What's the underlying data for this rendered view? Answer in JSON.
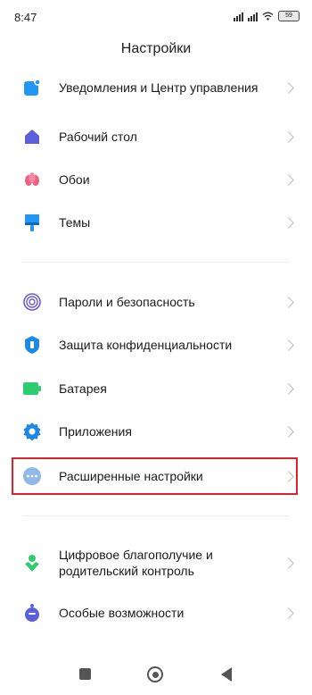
{
  "status_bar": {
    "time": "8:47",
    "battery": "59"
  },
  "header": {
    "title": "Настройки"
  },
  "items": [
    {
      "label": "Уведомления и Центр управления",
      "icon": "notifications-icon",
      "color": "#2196f3"
    },
    {
      "label": "Рабочий стол",
      "icon": "home-icon",
      "color": "#5b5fd9"
    },
    {
      "label": "Обои",
      "icon": "wallpaper-flower-icon",
      "color": "#ef5f86"
    },
    {
      "label": "Темы",
      "icon": "themes-brush-icon",
      "color": "#2196f3"
    },
    {
      "label": "Пароли и безопасность",
      "icon": "fingerprint-icon",
      "color": "#6a5acd"
    },
    {
      "label": "Защита конфиденциальности",
      "icon": "privacy-shield-icon",
      "color": "#1e88e5"
    },
    {
      "label": "Батарея",
      "icon": "battery-icon",
      "color": "#2ecc71"
    },
    {
      "label": "Приложения",
      "icon": "apps-gear-icon",
      "color": "#1e88e5"
    },
    {
      "label": "Расширенные настройки",
      "icon": "more-dots-icon",
      "color": "#90b8e8"
    },
    {
      "label": "Цифровое благополучие и родительский контроль",
      "icon": "wellbeing-icon",
      "color": "#2ecc71"
    },
    {
      "label": "Особые возможности",
      "icon": "accessibility-icon",
      "color": "#5b5fd9"
    }
  ],
  "highlight_color": "#e0202a"
}
